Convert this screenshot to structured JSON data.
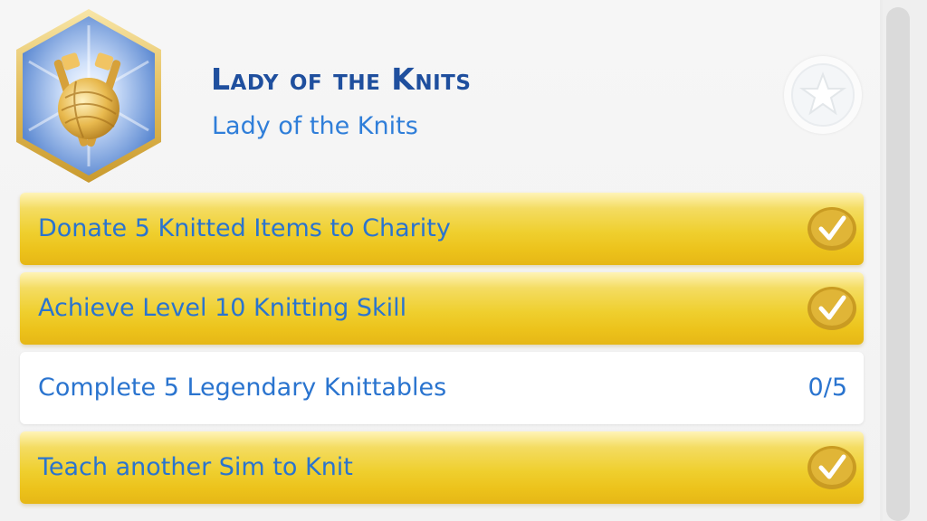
{
  "aspiration": {
    "title": "Lady of the Knits",
    "subtitle": "Lady of the Knits",
    "icon": "yarn-ball-knitting-needles-icon"
  },
  "favorite_icon": "star-icon",
  "goals": [
    {
      "label": "Donate 5 Knitted Items to Charity",
      "status": "complete",
      "icon": "checkmark-icon"
    },
    {
      "label": "Achieve Level 10 Knitting Skill",
      "status": "complete",
      "icon": "checkmark-icon"
    },
    {
      "label": "Complete 5 Legendary Knittables",
      "status": "incomplete",
      "progress": "0/5"
    },
    {
      "label": "Teach another Sim to Knit",
      "status": "complete",
      "icon": "checkmark-icon"
    }
  ],
  "colors": {
    "title": "#1f4f9e",
    "text": "#2a74cf",
    "gold": "#efcf2e",
    "badge_blue": "#5f8fd6"
  }
}
